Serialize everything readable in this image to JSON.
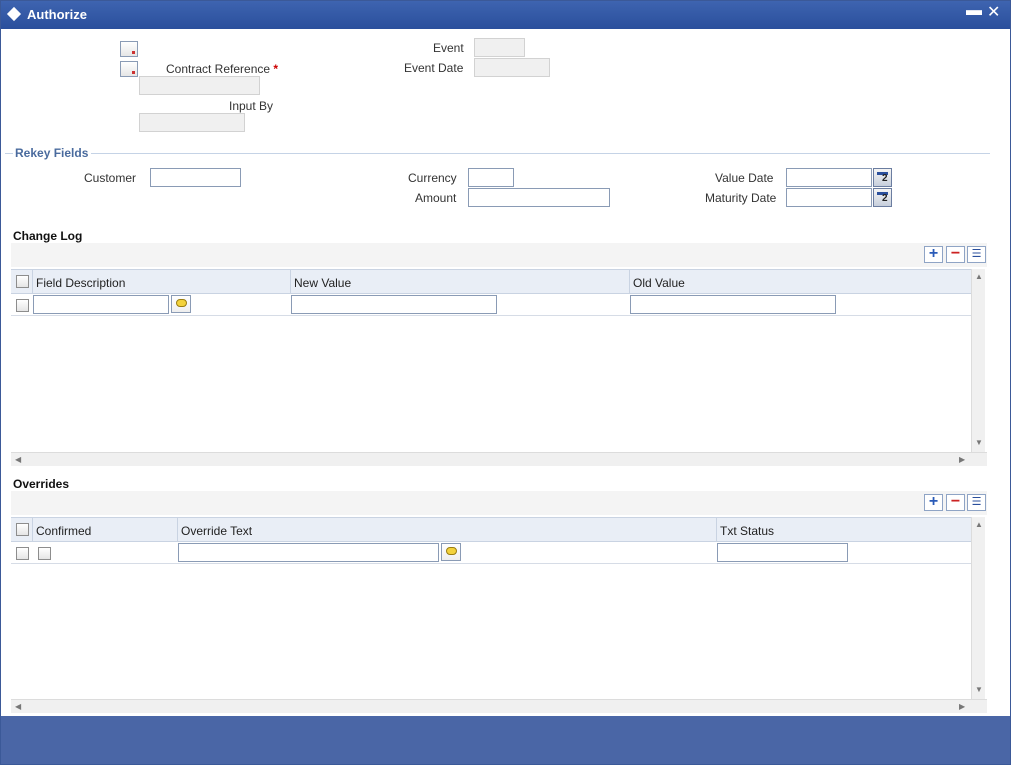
{
  "window": {
    "title": "Authorize",
    "minimize": "▬",
    "close": "✕"
  },
  "header": {
    "contract_reference_label": "Contract Reference",
    "required_mark": "*",
    "input_by_label": "Input By",
    "event_label": "Event",
    "event_date_label": "Event Date"
  },
  "rekey": {
    "section_title": "Rekey Fields",
    "customer_label": "Customer",
    "currency_label": "Currency",
    "amount_label": "Amount",
    "value_date_label": "Value Date",
    "maturity_date_label": "Maturity Date",
    "calendar_digit": "2"
  },
  "change_log": {
    "title": "Change Log",
    "columns": [
      "Field Description",
      "New Value",
      "Old Value"
    ]
  },
  "overrides": {
    "title": "Overrides",
    "columns": [
      "Confirmed",
      "Override Text",
      "Txt Status"
    ]
  },
  "toolbar": {
    "add": "+",
    "delete": "−",
    "list": "☰"
  },
  "scroll": {
    "up": "▲",
    "down": "▼",
    "left": "◀",
    "right": "▶"
  }
}
